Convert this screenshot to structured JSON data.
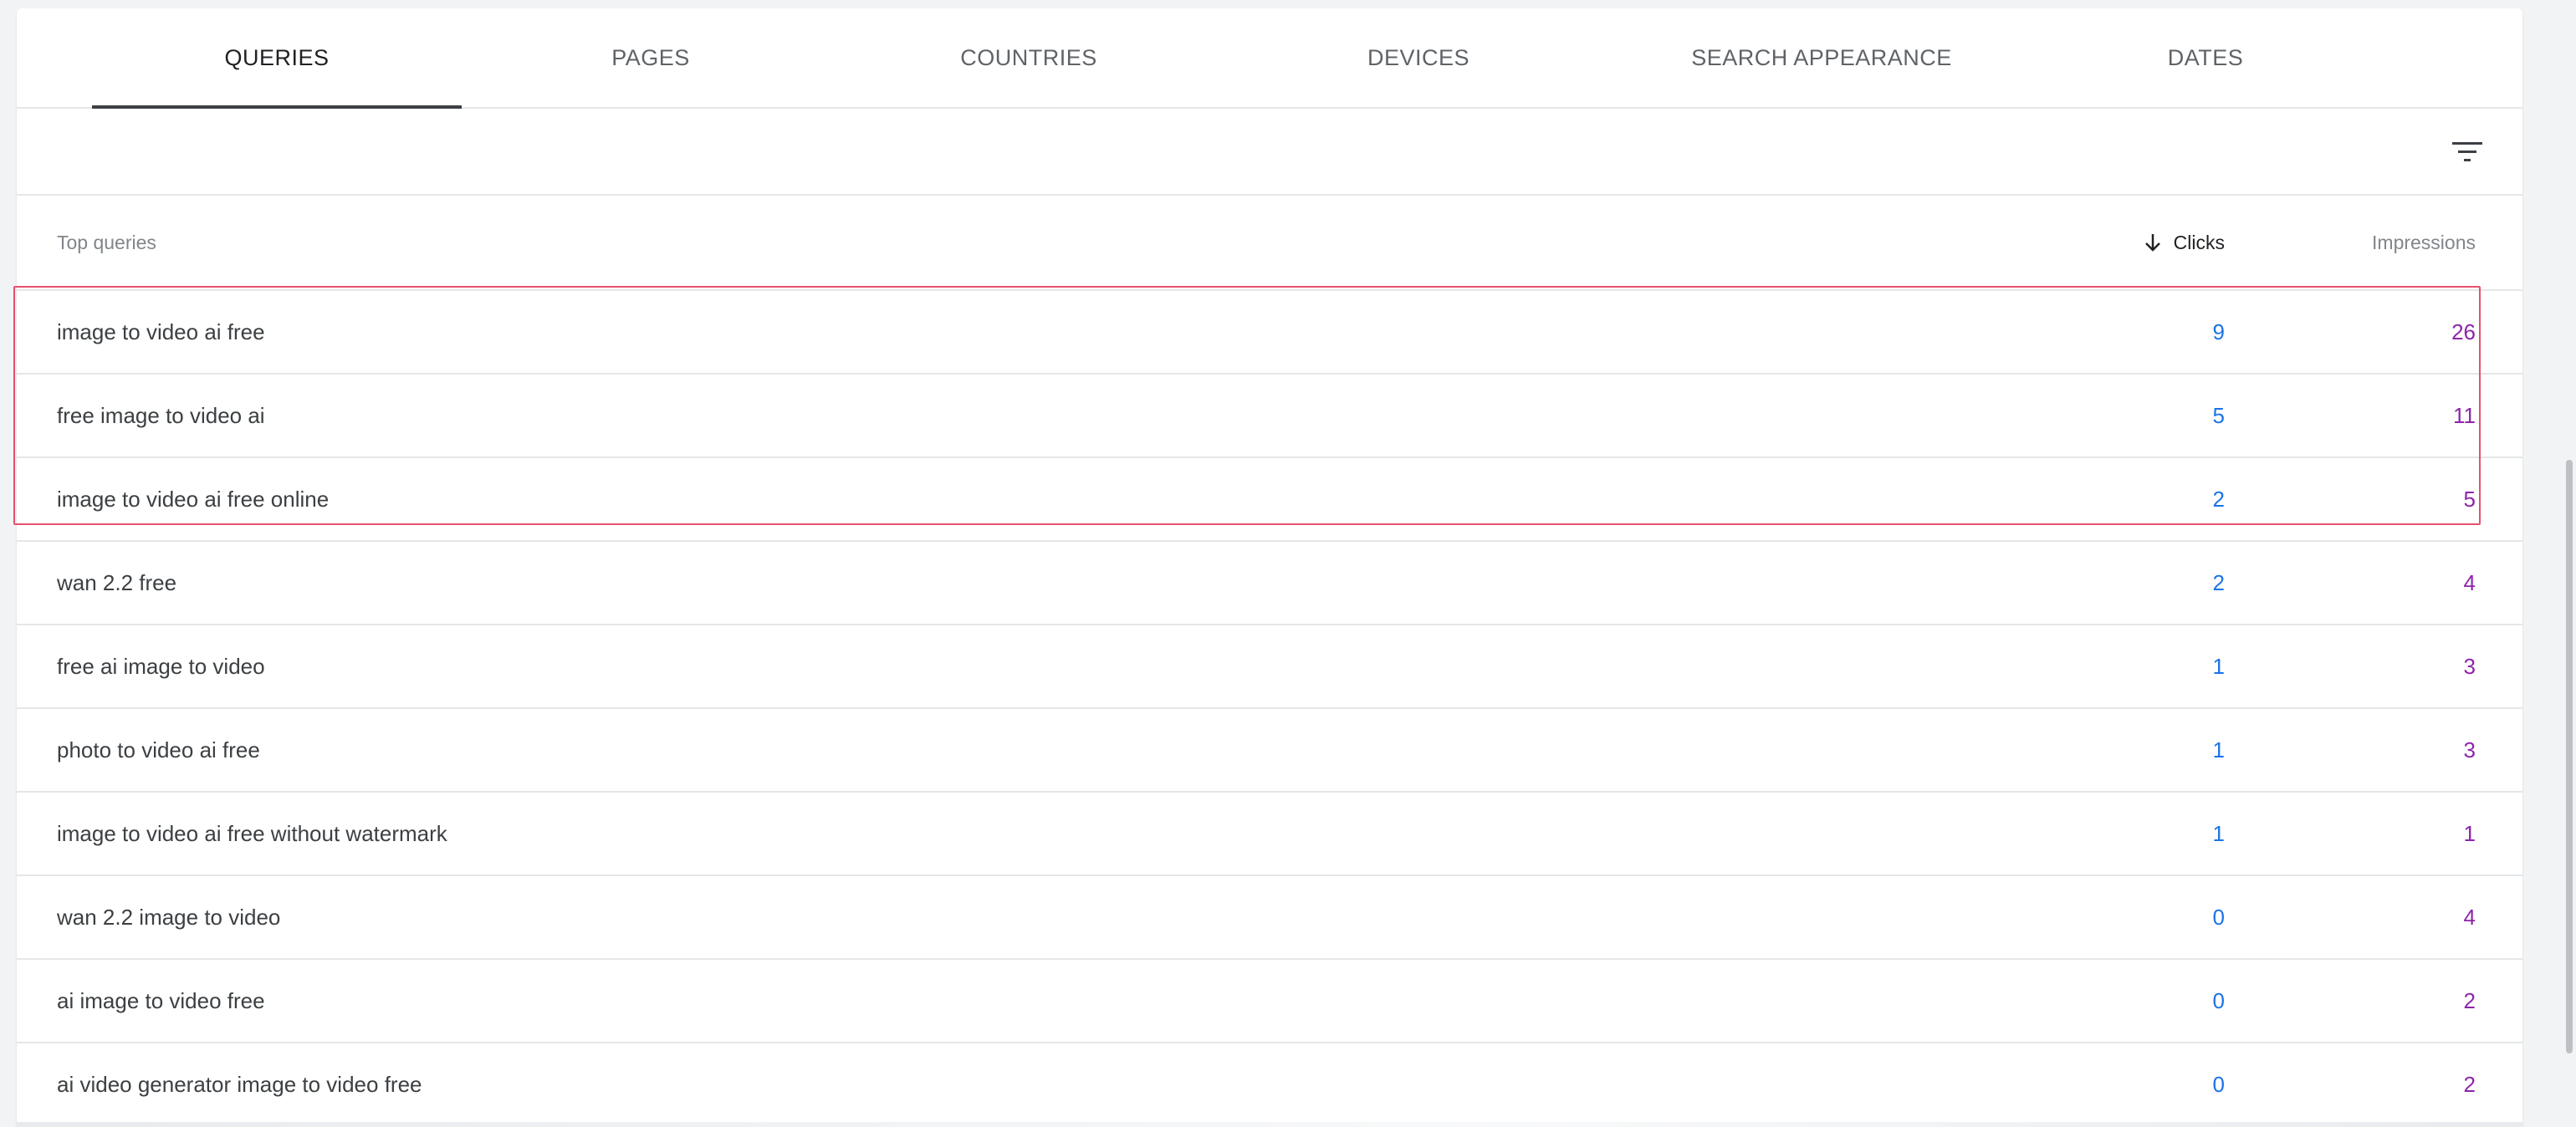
{
  "tabs": [
    {
      "label": "QUERIES",
      "active": true
    },
    {
      "label": "PAGES",
      "active": false
    },
    {
      "label": "COUNTRIES",
      "active": false
    },
    {
      "label": "DEVICES",
      "active": false
    },
    {
      "label": "SEARCH APPEARANCE",
      "active": false
    },
    {
      "label": "DATES",
      "active": false
    }
  ],
  "toolbar": {
    "filter_icon": "filter-list-icon"
  },
  "table": {
    "headers": {
      "query": "Top queries",
      "clicks": "Clicks",
      "impressions": "Impressions",
      "sort_icon": "arrow-down-icon"
    },
    "rows": [
      {
        "query": "image to video ai free",
        "clicks": "9",
        "impressions": "26"
      },
      {
        "query": "free image to video ai",
        "clicks": "5",
        "impressions": "11"
      },
      {
        "query": "image to video ai free online",
        "clicks": "2",
        "impressions": "5"
      },
      {
        "query": "wan 2.2 free",
        "clicks": "2",
        "impressions": "4"
      },
      {
        "query": "free ai image to video",
        "clicks": "1",
        "impressions": "3"
      },
      {
        "query": "photo to video ai free",
        "clicks": "1",
        "impressions": "3"
      },
      {
        "query": "image to video ai free without watermark",
        "clicks": "1",
        "impressions": "1"
      },
      {
        "query": "wan 2.2 image to video",
        "clicks": "0",
        "impressions": "4"
      },
      {
        "query": "ai image to video free",
        "clicks": "0",
        "impressions": "2"
      },
      {
        "query": "ai video generator image to video free",
        "clicks": "0",
        "impressions": "2"
      }
    ]
  },
  "colors": {
    "clicks": "#1a73e8",
    "impressions": "#8e24aa",
    "highlight": "#e8506e"
  }
}
